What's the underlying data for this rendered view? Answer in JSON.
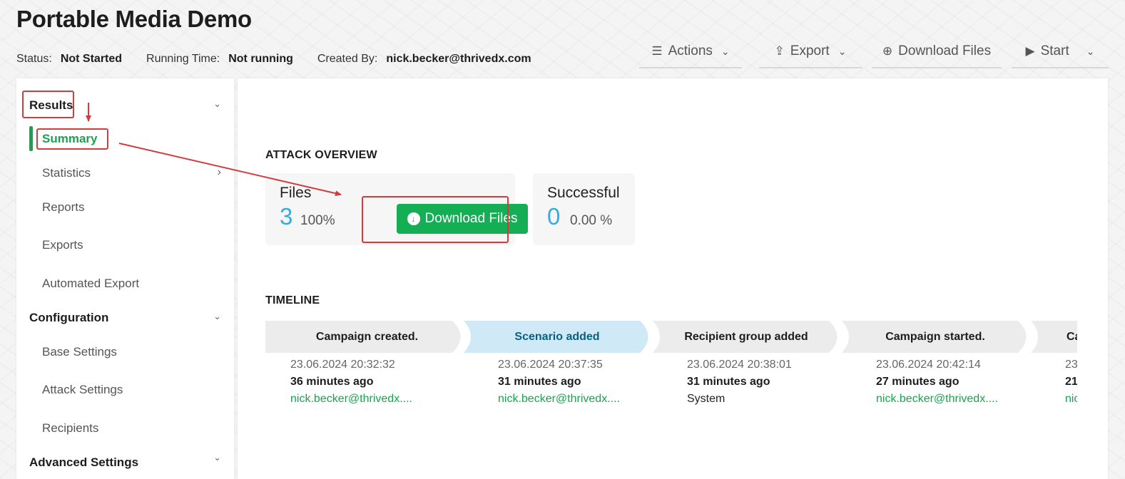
{
  "header": {
    "title": "Portable Media Demo",
    "status_label": "Status:",
    "status_value": "Not Started",
    "running_label": "Running Time:",
    "running_value": "Not running",
    "created_label": "Created By:",
    "created_value": "nick.becker@thrivedx.com"
  },
  "toolbar": {
    "actions": "Actions",
    "export": "Export",
    "download": "Download Files",
    "start": "Start"
  },
  "sidebar": {
    "results": "Results",
    "summary": "Summary",
    "statistics": "Statistics",
    "reports": "Reports",
    "exports": "Exports",
    "automated_export": "Automated Export",
    "configuration": "Configuration",
    "base_settings": "Base Settings",
    "attack_settings": "Attack Settings",
    "recipients": "Recipients",
    "advanced_settings": "Advanced Settings"
  },
  "overview": {
    "title": "ATTACK OVERVIEW",
    "files_label": "Files",
    "files_count": "3",
    "files_pct": "100%",
    "download_button": "Download Files",
    "successful_label": "Successful",
    "successful_count": "0",
    "successful_pct": "0.00 %"
  },
  "timeline": {
    "title": "TIMELINE",
    "steps": [
      {
        "label": "Campaign created.",
        "date": "23.06.2024 20:32:32",
        "ago": "36 minutes ago",
        "user": "nick.becker@thrivedx...."
      },
      {
        "label": "Scenario added",
        "date": "23.06.2024 20:37:35",
        "ago": "31 minutes ago",
        "user": "nick.becker@thrivedx...."
      },
      {
        "label": "Recipient group added",
        "date": "23.06.2024 20:38:01",
        "ago": "31 minutes ago",
        "user": "System"
      },
      {
        "label": "Campaign started.",
        "date": "23.06.2024 20:42:14",
        "ago": "27 minutes ago",
        "user": "nick.becker@thrivedx...."
      },
      {
        "label": "Ca",
        "date": "23",
        "ago": "21",
        "user": "nic"
      }
    ]
  },
  "colors": {
    "accent_green": "#15ae55",
    "highlight_blue": "#cfe9f7",
    "annotation_red": "#d33c3c"
  }
}
